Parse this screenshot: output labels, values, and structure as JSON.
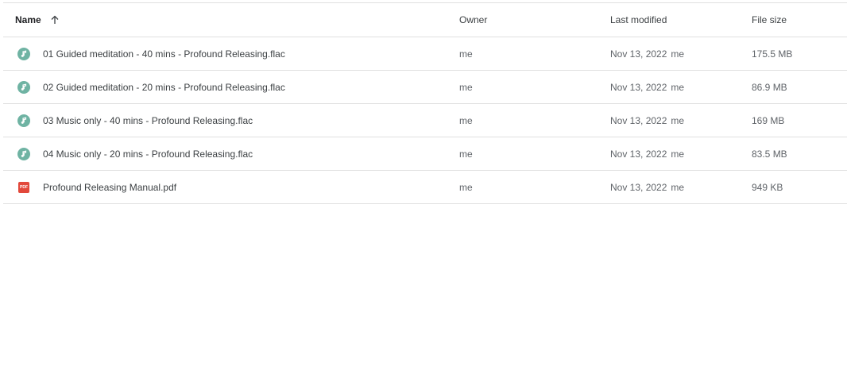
{
  "table": {
    "headers": {
      "name": "Name",
      "owner": "Owner",
      "last_modified": "Last modified",
      "file_size": "File size"
    },
    "sort_icon": "arrow-up-icon",
    "rows": [
      {
        "name": "01 Guided meditation - 40 mins - Profound Releasing.flac",
        "icon": "audio-file-icon",
        "owner": "me",
        "modified_date": "Nov 13, 2022",
        "modified_by": "me",
        "size": "175.5 MB"
      },
      {
        "name": "02 Guided meditation - 20 mins - Profound Releasing.flac",
        "icon": "audio-file-icon",
        "owner": "me",
        "modified_date": "Nov 13, 2022",
        "modified_by": "me",
        "size": "86.9 MB"
      },
      {
        "name": "03 Music only - 40 mins - Profound Releasing.flac",
        "icon": "audio-file-icon",
        "owner": "me",
        "modified_date": "Nov 13, 2022",
        "modified_by": "me",
        "size": "169 MB"
      },
      {
        "name": "04 Music only - 20 mins - Profound Releasing.flac",
        "icon": "audio-file-icon",
        "owner": "me",
        "modified_date": "Nov 13, 2022",
        "modified_by": "me",
        "size": "83.5 MB"
      },
      {
        "name": "Profound Releasing Manual.pdf",
        "icon": "pdf-file-icon",
        "icon_text": "PDF",
        "owner": "me",
        "modified_date": "Nov 13, 2022",
        "modified_by": "me",
        "size": "949 KB"
      }
    ]
  },
  "colors": {
    "audio_icon": "#6fb3a3",
    "pdf_icon": "#e2483b",
    "divider": "#e0e0e0"
  }
}
